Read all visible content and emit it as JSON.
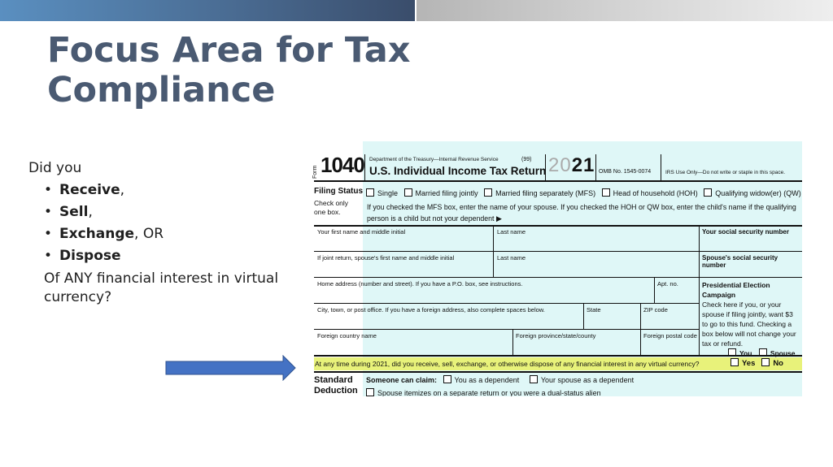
{
  "slide": {
    "title_line1": "Focus Area for Tax",
    "title_line2": "Compliance",
    "intro": "Did you",
    "bullets": [
      {
        "bold": "Receive",
        "rest": ","
      },
      {
        "bold": "Sell",
        "rest": ","
      },
      {
        "bold": "Exchange",
        "rest": ", OR"
      },
      {
        "bold": "Dispose",
        "rest": ""
      }
    ],
    "bullet_char": "•",
    "outro": "Of ANY financial interest in virtual currency?"
  },
  "form": {
    "form_word": "Form",
    "form_number": "1040",
    "department": "Department of the Treasury—Internal Revenue Service",
    "code_99": "(99)",
    "title": "U.S. Individual Income Tax Return",
    "year_prefix": "20",
    "year_suffix": "21",
    "omb": "OMB No. 1545-0074",
    "irs_use": "IRS Use Only—Do not write or staple in this space.",
    "filing_status_label": "Filing Status",
    "filing_status_note": "Check only one box.",
    "filing_options": [
      "Single",
      "Married filing jointly",
      "Married filing separately (MFS)",
      "Head of household (HOH)",
      "Qualifying widow(er) (QW)"
    ],
    "filing_help_1": "If you checked the MFS box, enter the name of your spouse. If you checked the HOH or QW box, enter the child's name if the qualifying",
    "filing_help_2": "person is a child but not your dependent ▶",
    "first_name": "Your first name and middle initial",
    "last_name": "Last name",
    "ssn": "Your social security number",
    "spouse_first_name": "If joint return, spouse's first name and middle initial",
    "spouse_last_name": "Last name",
    "spouse_ssn": "Spouse's social security number",
    "home_address": "Home address (number and street). If you have a P.O. box, see instructions.",
    "apt_no": "Apt. no.",
    "pec_title": "Presidential Election Campaign",
    "pec_text": "Check here if you, or your spouse if filing jointly, want $3 to go to this fund. Checking a box below will not change your tax or refund.",
    "pec_you": "You",
    "pec_spouse": "Spouse",
    "city": "City, town, or post office. If you have a foreign address, also complete spaces below.",
    "state": "State",
    "zip": "ZIP code",
    "foreign_country": "Foreign country name",
    "foreign_province": "Foreign province/state/county",
    "foreign_postal": "Foreign postal code",
    "virtual_currency_question": "At any time during 2021, did you receive, sell, exchange, or otherwise dispose of any financial interest in any virtual currency?",
    "yes": "Yes",
    "no": "No",
    "standard_deduction_1": "Standard",
    "standard_deduction_2": "Deduction",
    "someone_can_claim": "Someone can claim:",
    "you_as_dependent": "You as a dependent",
    "spouse_as_dependent": "Your spouse as a dependent",
    "spouse_itemizes": "Spouse itemizes on a separate return or you were a dual-status alien"
  },
  "colors": {
    "title": "#4a5a72",
    "arrow": "#4472c4",
    "form_tint": "#dff7f7",
    "highlight": "#e8f27a"
  }
}
